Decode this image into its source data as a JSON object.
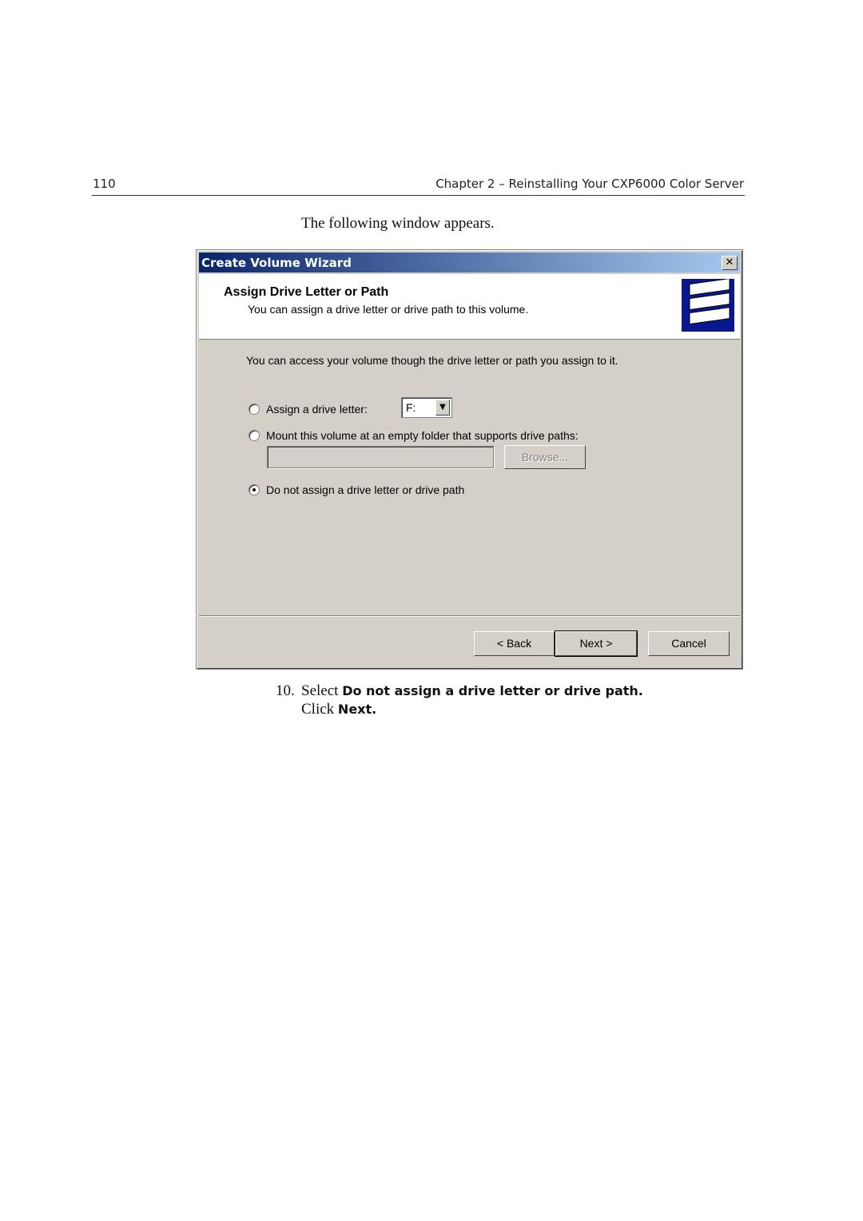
{
  "page_header": {
    "page_number": "110",
    "chapter": "Chapter 2 – Reinstalling Your CXP6000 Color Server"
  },
  "intro": "The following window appears.",
  "dialog": {
    "title": "Create Volume Wizard",
    "close_icon": "close-icon",
    "header_title": "Assign Drive Letter or Path",
    "header_subtitle": "You can assign a drive letter or drive path to this volume.",
    "header_icon": "disk-stack-icon",
    "description": "You can access your volume though the drive letter or path you assign to it.",
    "options": [
      {
        "label": "Assign a drive letter:",
        "selected": false
      },
      {
        "label": "Mount this volume at an empty folder that supports drive paths:",
        "selected": false
      },
      {
        "label": "Do not assign a drive letter or drive path",
        "selected": true
      }
    ],
    "drive_letter_value": "F:",
    "path_value": "",
    "browse_label": "Browse...",
    "buttons": {
      "back": "< Back",
      "next": "Next >",
      "cancel": "Cancel"
    }
  },
  "step": {
    "number": "10.",
    "text1": "Select ",
    "bold1": "Do not assign a drive letter or drive path.",
    "text2": "Click ",
    "bold2": "Next."
  }
}
